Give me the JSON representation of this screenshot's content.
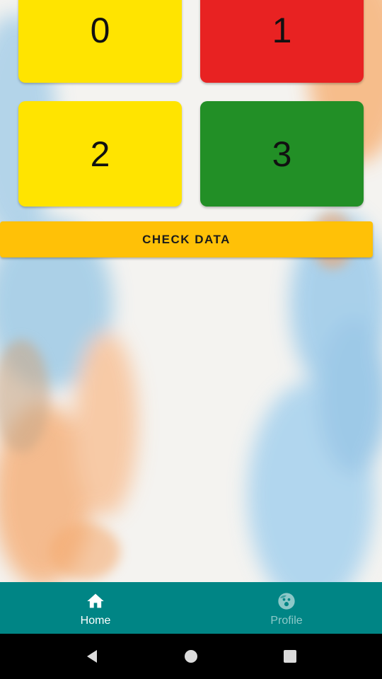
{
  "tiles": [
    {
      "label": "0",
      "color": "#FFE400"
    },
    {
      "label": "1",
      "color": "#E82222"
    },
    {
      "label": "2",
      "color": "#FFE400"
    },
    {
      "label": "3",
      "color": "#228F26"
    }
  ],
  "check_button": {
    "label": "CHECK DATA",
    "color": "#FFC107"
  },
  "bottom_nav": {
    "background": "#008585",
    "items": [
      {
        "label": "Home",
        "icon": "home-icon",
        "active": true
      },
      {
        "label": "Profile",
        "icon": "face-icon",
        "active": false
      }
    ]
  },
  "system_nav": {
    "buttons": [
      "back-icon",
      "home-circle-icon",
      "recents-square-icon"
    ]
  }
}
